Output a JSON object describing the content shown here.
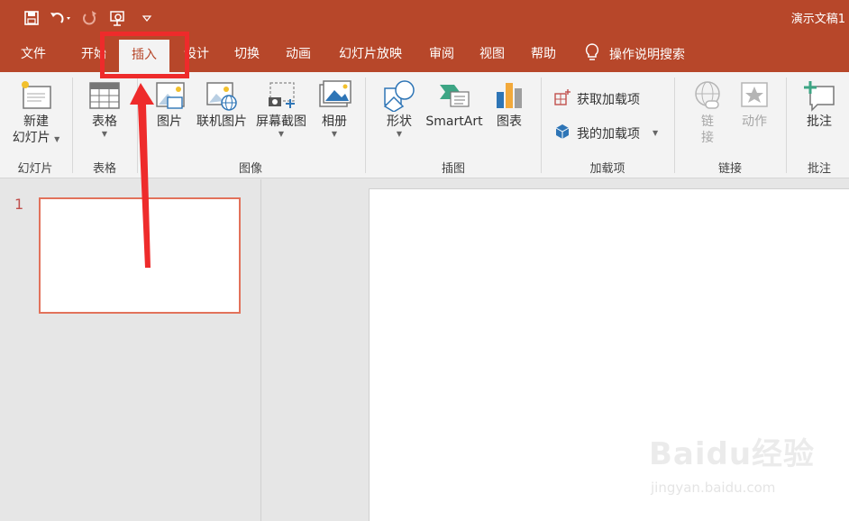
{
  "window": {
    "title": "演示文稿1"
  },
  "quick_access": [
    "save-icon",
    "undo-icon",
    "redo-icon",
    "present-from-start-icon",
    "customize-qat-icon"
  ],
  "tabs": [
    {
      "label": "文件"
    },
    {
      "label": "开始"
    },
    {
      "label": "插入",
      "active": true
    },
    {
      "label": "设计"
    },
    {
      "label": "切换"
    },
    {
      "label": "动画"
    },
    {
      "label": "幻灯片放映"
    },
    {
      "label": "审阅"
    },
    {
      "label": "视图"
    },
    {
      "label": "帮助"
    }
  ],
  "tell_me": {
    "label": "操作说明搜索",
    "icon": "lightbulb-icon"
  },
  "ribbon": {
    "slides_group": {
      "label": "幻灯片",
      "new_slide_line1": "新建",
      "new_slide_line2": "幻灯片"
    },
    "table_group": {
      "label": "表格",
      "table": "表格"
    },
    "images_group": {
      "label": "图像",
      "pictures": "图片",
      "online_pictures": "联机图片",
      "screenshot": "屏幕截图",
      "album": "相册"
    },
    "illustrations_group": {
      "label": "插图",
      "shapes": "形状",
      "smartart": "SmartArt",
      "chart": "图表"
    },
    "addins_group": {
      "label": "加载项",
      "get_addins": "获取加载项",
      "my_addins": "我的加载项"
    },
    "links_group": {
      "label": "链接",
      "link_line1": "链",
      "link_line2": "接",
      "action": "动作"
    },
    "comments_group": {
      "label": "批注",
      "comment": "批注"
    }
  },
  "thumbnails": [
    {
      "number": "1"
    }
  ],
  "colors": {
    "accent": "#b7472a",
    "annotation": "#ee2b2b",
    "thumb_border": "#e2725b"
  },
  "watermark": {
    "brand": "Baidu经验",
    "url": "jingyan.baidu.com"
  }
}
